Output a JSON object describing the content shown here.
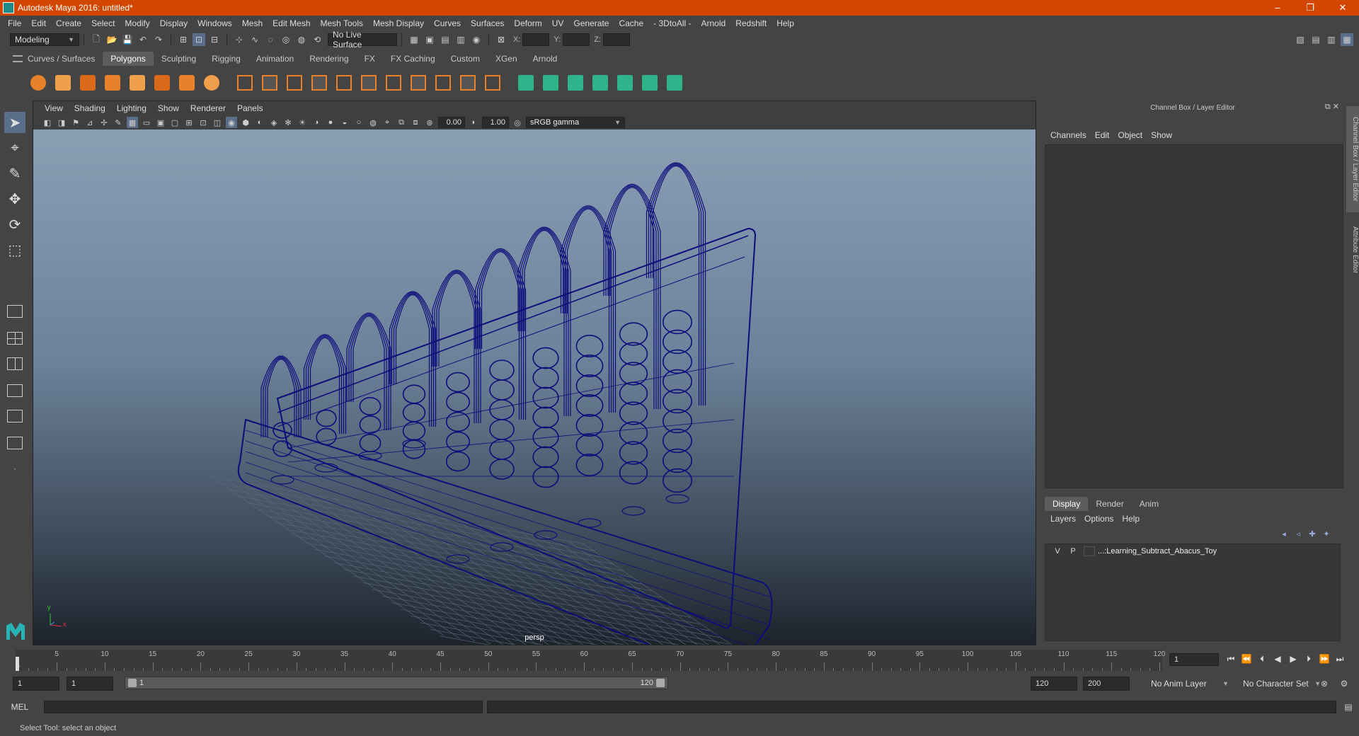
{
  "window": {
    "title": "Autodesk Maya 2016: untitled*",
    "minimize": "–",
    "restore": "❐",
    "close": "✕"
  },
  "menubar": [
    "File",
    "Edit",
    "Create",
    "Select",
    "Modify",
    "Display",
    "Windows",
    "Mesh",
    "Edit Mesh",
    "Mesh Tools",
    "Mesh Display",
    "Curves",
    "Surfaces",
    "Deform",
    "UV",
    "Generate",
    "Cache",
    "- 3DtoAll -",
    "Arnold",
    "Redshift",
    "Help"
  ],
  "statusline": {
    "mode": "Modeling",
    "live_surface": "No Live Surface",
    "x_label": "X:",
    "y_label": "Y:",
    "z_label": "Z:"
  },
  "shelf": {
    "tabs": [
      "Curves / Surfaces",
      "Polygons",
      "Sculpting",
      "Rigging",
      "Animation",
      "Rendering",
      "FX",
      "FX Caching",
      "Custom",
      "XGen",
      "Arnold"
    ],
    "active_tab": "Polygons",
    "icons": [
      "sphere-icon",
      "cube-icon",
      "cylinder-icon",
      "cone-icon",
      "plane-icon",
      "torus-icon",
      "pyramid-icon",
      "pipe-icon",
      "combine-icon",
      "separate-icon",
      "extract-icon",
      "smooth-icon",
      "bevel-icon",
      "bridge-icon",
      "extrude-icon",
      "append-icon",
      "multicut-icon",
      "target-weld-icon",
      "insert-edgeloop-icon",
      "split-icon",
      "uv-icon",
      "planar-map-icon",
      "automatic-map-icon",
      "uv-editor-icon",
      "grid-icon",
      "move-uv-icon"
    ]
  },
  "viewport": {
    "menu": [
      "View",
      "Shading",
      "Lighting",
      "Show",
      "Renderer",
      "Panels"
    ],
    "exposure": "0.00",
    "gamma": "1.00",
    "color_space": "sRGB gamma",
    "camera": "persp",
    "axis_y": "y",
    "axis_x": "x"
  },
  "channelbox": {
    "title": "Channel Box / Layer Editor",
    "menu": [
      "Channels",
      "Edit",
      "Object",
      "Show"
    ],
    "layer_tabs": [
      "Display",
      "Render",
      "Anim"
    ],
    "active_layer_tab": "Display",
    "layer_menu": [
      "Layers",
      "Options",
      "Help"
    ],
    "layers": [
      {
        "v": "V",
        "p": "P",
        "name": "...:Learning_Subtract_Abacus_Toy"
      }
    ],
    "side_tabs": [
      "Channel Box / Layer Editor",
      "Attribute Editor"
    ]
  },
  "timeslider": {
    "ticks": [
      1,
      5,
      10,
      15,
      20,
      25,
      30,
      35,
      40,
      45,
      50,
      55,
      60,
      65,
      70,
      75,
      80,
      85,
      90,
      95,
      100,
      105,
      110,
      115,
      120
    ],
    "min": 1,
    "max": 120,
    "current_frame": "1"
  },
  "range": {
    "start": "1",
    "start_inner": "1",
    "bar_start": "1",
    "bar_end": "120",
    "end_inner": "120",
    "end": "200",
    "anim_layer": "No Anim Layer",
    "character_set": "No Character Set"
  },
  "cmdline": {
    "label": "MEL"
  },
  "helpline": {
    "text": "Select Tool: select an object"
  },
  "colors": {
    "title_bar": "#d24600",
    "wireframe": "#0d0d7a",
    "accent": "#5d5d5d"
  }
}
